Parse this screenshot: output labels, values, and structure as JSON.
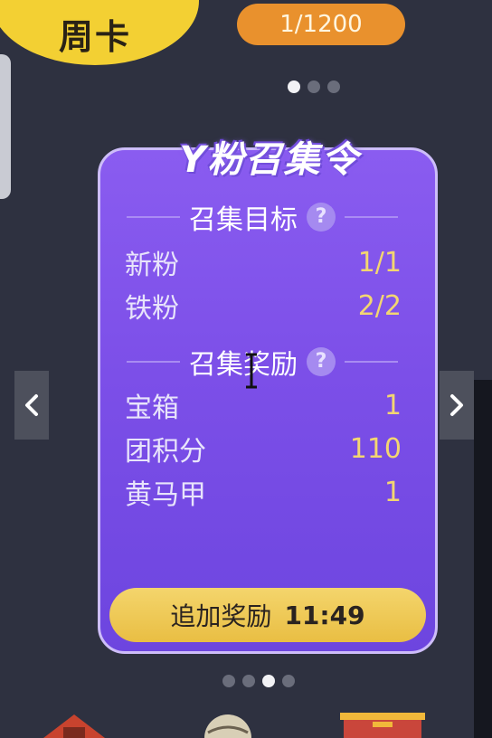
{
  "week_card": {
    "label": "周卡"
  },
  "counter": {
    "text": "1/1200"
  },
  "card": {
    "title": "Y粉召集令",
    "goal_section": {
      "heading": "召集目标",
      "rows": [
        {
          "label": "新粉",
          "value": "1/1"
        },
        {
          "label": "铁粉",
          "value": "2/2"
        }
      ]
    },
    "reward_section": {
      "heading": "召集奖励",
      "rows": [
        {
          "label": "宝箱",
          "value": "1"
        },
        {
          "label": "团积分",
          "value": "110"
        },
        {
          "label": "黄马甲",
          "value": "1"
        }
      ]
    },
    "bonus_button": {
      "label": "追加奖励",
      "time": "11:49"
    }
  },
  "pagination_top": {
    "count": 3,
    "active_index": 0
  },
  "pagination_bottom": {
    "count": 4,
    "active_index": 2
  },
  "icons": {
    "help": "question-circle-icon",
    "prev": "chevron-left-icon",
    "next": "chevron-right-icon",
    "cursor": "text-cursor-icon"
  },
  "colors": {
    "card_purple": "#7c4fe8",
    "value_gold": "#f3d671",
    "button_gold": "#f4d56c",
    "counter_orange": "#e9912d",
    "weekcard_yellow": "#f3d033"
  }
}
